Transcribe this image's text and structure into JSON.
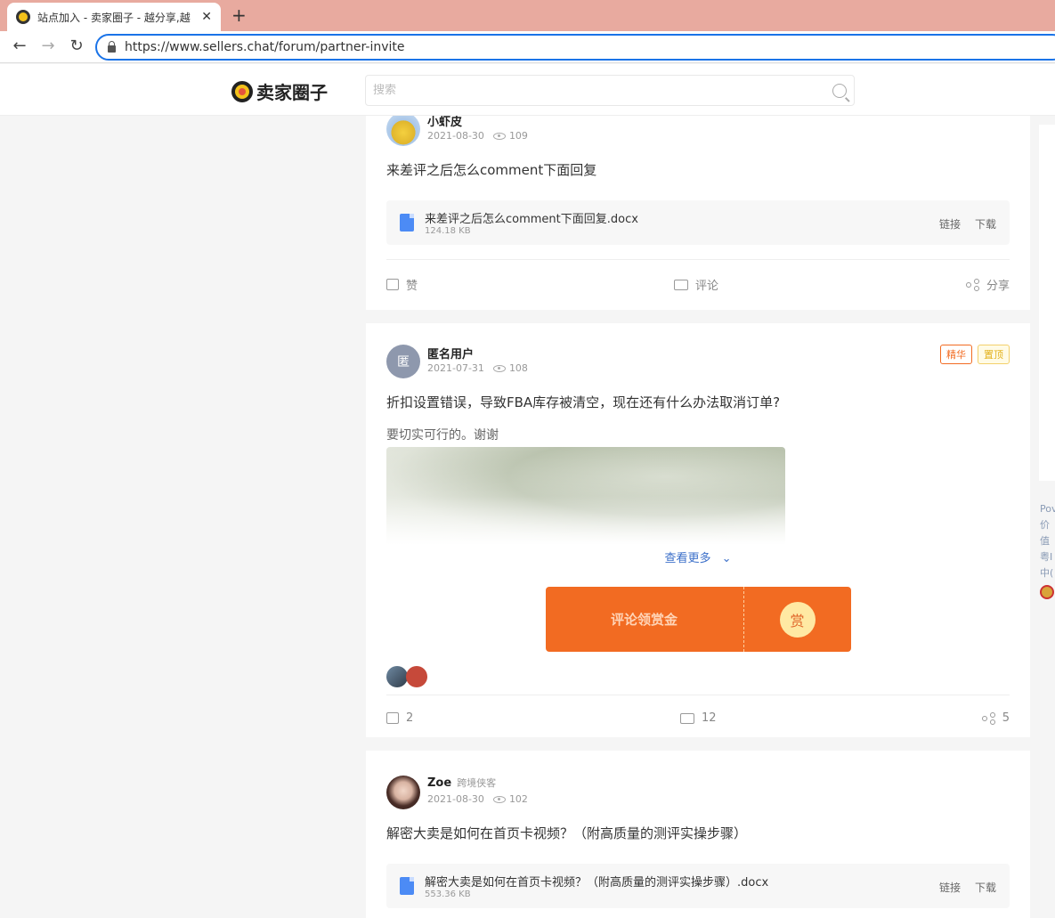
{
  "browser": {
    "tab_title": "站点加入 - 卖家圈子 - 越分享,越",
    "url": "https://www.sellers.chat/forum/partner-invite"
  },
  "site": {
    "logo_text": "卖家圈子",
    "search_placeholder": "搜索"
  },
  "right_footer": {
    "lines": [
      "Pov",
      "价值",
      "粤I",
      "中("
    ]
  },
  "posts": [
    {
      "author": "小虾皮",
      "date": "2021-08-30",
      "views": "109",
      "title": "来差评之后怎么comment下面回复",
      "attachment": {
        "name": "来差评之后怎么comment下面回复.docx",
        "size": "124.18 KB",
        "link_label": "链接",
        "download_label": "下载"
      },
      "actions": {
        "like": "赞",
        "comment": "评论",
        "share": "分享"
      }
    },
    {
      "author": "匿名用户",
      "avatar_text": "匿",
      "date": "2021-07-31",
      "views": "108",
      "tags": [
        "精华",
        "置顶"
      ],
      "title": "折扣设置错误，导致FBA库存被清空，现在还有什么办法取消订单?",
      "body": "要切实可行的。谢谢",
      "see_more": "查看更多",
      "reward": {
        "label": "评论领赏金",
        "coin": "赏"
      },
      "actions": {
        "like": "2",
        "comment": "12",
        "share": "5"
      }
    },
    {
      "author": "Zoe",
      "author_tag": "跨境侠客",
      "date": "2021-08-30",
      "views": "102",
      "title": "解密大卖是如何在首页卡视频？（附高质量的测评实操步骤）",
      "attachment": {
        "name": "解密大卖是如何在首页卡视频？（附高质量的测评实操步骤）.docx",
        "size": "553.36 KB",
        "link_label": "链接",
        "download_label": "下载"
      }
    }
  ],
  "colors": {
    "accent": "#f26b22",
    "link": "#3b6fc9",
    "tabbar": "#e8aa9f"
  }
}
